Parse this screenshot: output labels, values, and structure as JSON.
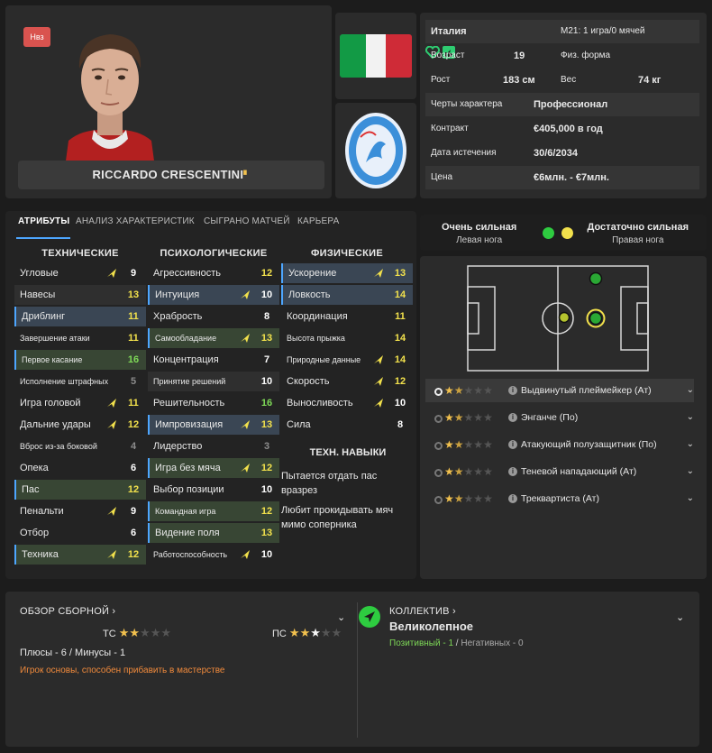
{
  "player": {
    "nat_badge": "Нвз",
    "name": "RICCARDO CRESCENTINI",
    "name_mark": "▘"
  },
  "info": {
    "nation": "Италия",
    "u21": "M21: 1 игра/0 мячей",
    "age_label": "Возраст",
    "age": "19",
    "fitness_label": "Физ. форма",
    "height_label": "Рост",
    "height": "183 см",
    "weight_label": "Вес",
    "weight": "74 кг",
    "personality_label": "Черты характера",
    "personality": "Профессионал",
    "contract_label": "Контракт",
    "contract": "€405,000 в год",
    "expiry_label": "Дата истечения",
    "expiry": "30/6/2034",
    "value_label": "Цена",
    "value": "€6млн. - €7млн."
  },
  "tabs": [
    "АТРИБУТЫ",
    "АНАЛИЗ ХАРАКТЕРИСТИК",
    "СЫГРАНО МАТЧЕЙ",
    "КАРЬЕРА"
  ],
  "columns": {
    "technical": "ТЕХНИЧЕСКИЕ",
    "mental": "ПСИХОЛОГИЧЕСКИЕ",
    "physical": "ФИЗИЧЕСКИЕ"
  },
  "technical": [
    {
      "label": "Угловые",
      "value": "9"
    },
    {
      "label": "Навесы",
      "value": "13"
    },
    {
      "label": "Дриблинг",
      "value": "11"
    },
    {
      "label": "Завершение атаки",
      "value": "11"
    },
    {
      "label": "Первое касание",
      "value": "16"
    },
    {
      "label": "Исполнение штрафных",
      "value": "5"
    },
    {
      "label": "Игра головой",
      "value": "11"
    },
    {
      "label": "Дальние удары",
      "value": "12"
    },
    {
      "label": "Вброс из-за боковой",
      "value": "4"
    },
    {
      "label": "Опека",
      "value": "6"
    },
    {
      "label": "Пас",
      "value": "12"
    },
    {
      "label": "Пенальти",
      "value": "9"
    },
    {
      "label": "Отбор",
      "value": "6"
    },
    {
      "label": "Техника",
      "value": "12"
    }
  ],
  "mental": [
    {
      "label": "Агрессивность",
      "value": "12"
    },
    {
      "label": "Интуиция",
      "value": "10"
    },
    {
      "label": "Храбрость",
      "value": "8"
    },
    {
      "label": "Самообладание",
      "value": "13"
    },
    {
      "label": "Концентрация",
      "value": "7"
    },
    {
      "label": "Принятие решений",
      "value": "10"
    },
    {
      "label": "Решительность",
      "value": "16"
    },
    {
      "label": "Импровизация",
      "value": "13"
    },
    {
      "label": "Лидерство",
      "value": "3"
    },
    {
      "label": "Игра без мяча",
      "value": "12"
    },
    {
      "label": "Выбор позиции",
      "value": "10"
    },
    {
      "label": "Командная игра",
      "value": "12"
    },
    {
      "label": "Видение поля",
      "value": "13"
    },
    {
      "label": "Работоспособность",
      "value": "10"
    }
  ],
  "physical": [
    {
      "label": "Ускорение",
      "value": "13"
    },
    {
      "label": "Ловкость",
      "value": "14"
    },
    {
      "label": "Координация",
      "value": "11"
    },
    {
      "label": "Высота прыжка",
      "value": "14"
    },
    {
      "label": "Природные данные",
      "value": "14"
    },
    {
      "label": "Скорость",
      "value": "12"
    },
    {
      "label": "Выносливость",
      "value": "10"
    },
    {
      "label": "Сила",
      "value": "8"
    }
  ],
  "tech_skills": {
    "title": "ТЕХН. НАВЫКИ",
    "items": [
      "Пытается отдать пас вразрез",
      "Любит прокидывать мяч мимо соперника"
    ]
  },
  "feet": {
    "left_title": "Очень сильная",
    "left_sub": "Левая нога",
    "right_title": "Достаточно сильная",
    "right_sub": "Правая нога",
    "left_color": "#2ecc40",
    "right_color": "#f2e14c"
  },
  "roles": [
    {
      "name": "Выдвинутый плеймейкер (Ат)"
    },
    {
      "name": "Энганче (По)"
    },
    {
      "name": "Атакующий полузащитник (По)"
    },
    {
      "name": "Теневой нападающий (Ат)"
    },
    {
      "name": "Треквартиста (Ат)"
    }
  ],
  "bottom": {
    "national_head": "ОБЗОР СБОРНОЙ",
    "ca_label": "ТС",
    "pa_label": "ПС",
    "pros_cons": "Плюсы - 6 / Минусы - 1",
    "scout_note": "Игрок основы, способен прибавить в мастерстве",
    "team_head": "КОЛЛЕКТИВ",
    "team_value": "Великолепное",
    "positive": "Позитивный - 1",
    "sep": " / ",
    "negative": "Негативных - 0"
  },
  "colors": {
    "accent_blue": "#4da6ff",
    "yellow": "#f2e14c",
    "green": "#7ed957",
    "orange_note": "#f08a3c",
    "star": "#f2c14e"
  }
}
